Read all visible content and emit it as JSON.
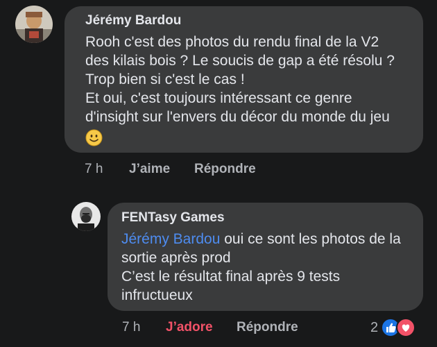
{
  "comment": {
    "author": "Jérémy Bardou",
    "lines": [
      "Rooh c'est des photos du rendu final de la V2",
      "des kilais bois ? Le soucis de gap a été résolu ?",
      "Trop bien si c'est le cas !",
      "Et oui, c'est toujours intéressant ce genre",
      "d'insight sur l'envers du décor du monde du jeu"
    ],
    "emoji": "slightly-smiling-face",
    "time": "7 h",
    "like_label": "J’aime",
    "reply_label": "Répondre"
  },
  "reply": {
    "author": "FENTasy Games",
    "mention": "Jérémy Bardou",
    "line1_rest": " oui ce sont les photos de la",
    "lines": [
      "sortie après prod",
      "C’est le résultat final après 9 tests",
      "infructueux"
    ],
    "time": "7 h",
    "love_label": "J’adore",
    "reply_label": "Répondre",
    "reaction_count": "2",
    "reaction_icons": [
      "like-icon",
      "love-icon"
    ]
  },
  "colors": {
    "background": "#18191a",
    "bubble": "#3a3b3c",
    "mention": "#4e8cf0",
    "love": "#f25268",
    "like": "#1b74e4"
  }
}
